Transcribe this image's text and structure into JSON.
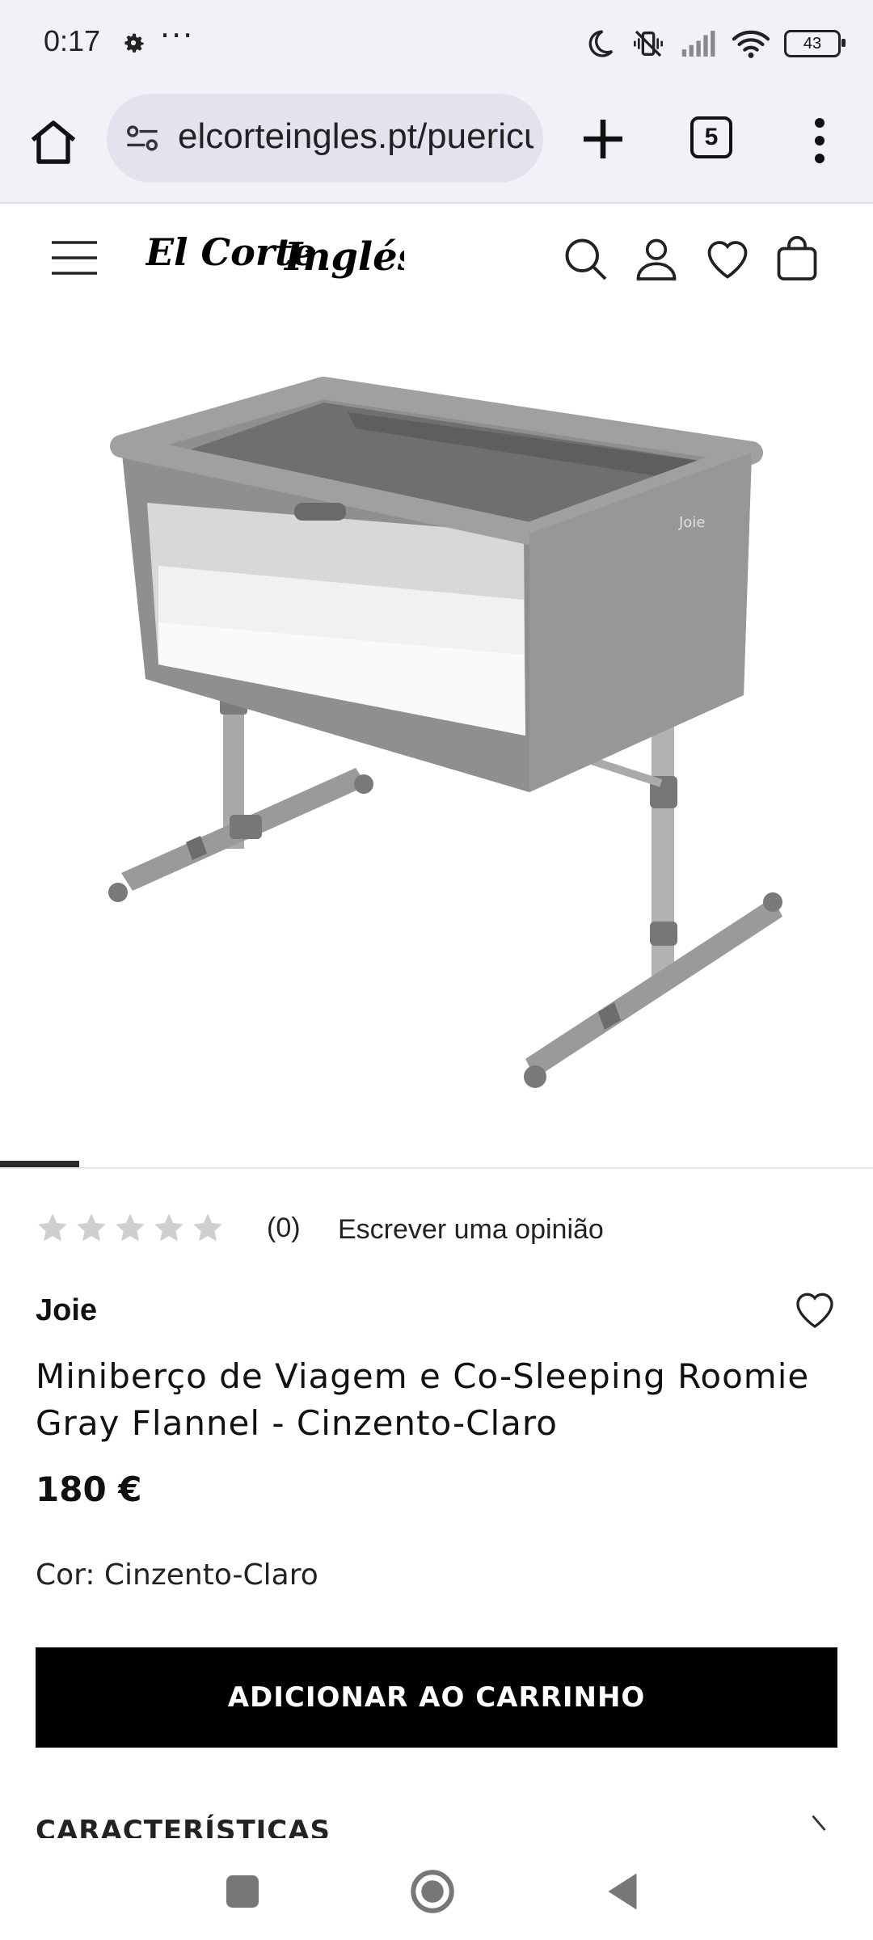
{
  "status_bar": {
    "time": "0:17",
    "dots": "···",
    "battery": "43",
    "icons": [
      "settings-gear-icon",
      "do-not-disturb-moon-icon",
      "vibrate-off-icon",
      "signal-icon",
      "wifi-icon",
      "battery-icon"
    ]
  },
  "browser": {
    "url": "elcorteingles.pt/puericultura",
    "tab_count": "5",
    "icons": [
      "home-icon",
      "site-settings-icon",
      "new-tab-plus-icon",
      "tabs-icon",
      "more-menu-icon"
    ]
  },
  "site": {
    "logo_text": "El Corte Inglés",
    "header_icons": [
      "menu-icon",
      "search-icon",
      "account-icon",
      "wishlist-heart-icon",
      "shopping-bag-icon"
    ]
  },
  "product": {
    "rating_stars": 0,
    "rating_max": 5,
    "review_count": "(0)",
    "write_review": "Escrever uma opinião",
    "brand": "Joie",
    "title": "Miniberço de Viagem e Co-Sleeping Roomie Gray Flannel - Cinzento-Claro",
    "price": "180 €",
    "color_label": "Cor: Cinzento-Claro",
    "add_to_cart": "ADICIONAR AO CARRINHO",
    "section_title": "CARACTERÍSTICAS",
    "carousel_position": 1
  },
  "colors": {
    "browser_bg": "#f2f1f8",
    "url_pill": "#e3e2ee",
    "button_bg": "#000000",
    "star_empty": "#cfcfcf",
    "crib_fabric": "#8c8c8c"
  },
  "nav": {
    "icons": [
      "recent-apps-square-icon",
      "home-circle-icon",
      "back-triangle-icon"
    ]
  }
}
